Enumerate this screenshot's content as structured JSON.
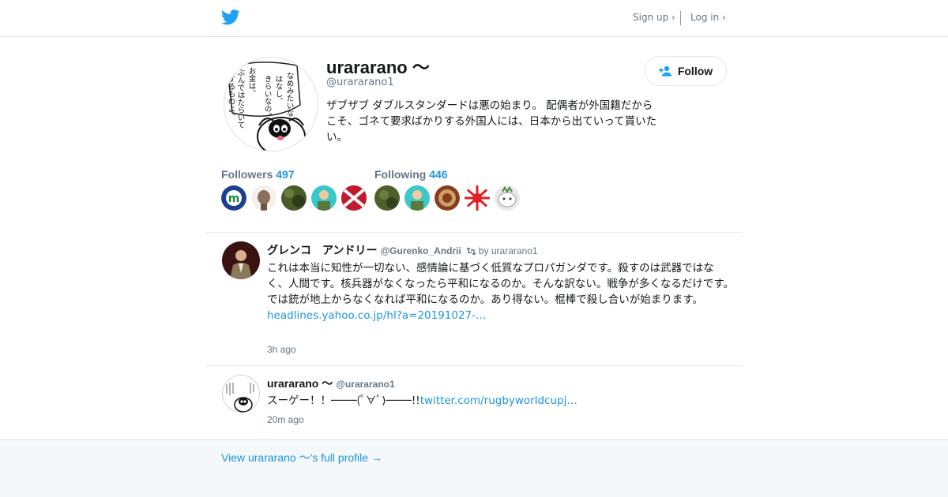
{
  "header": {
    "logo_icon": "twitter-bird-icon",
    "brand_color": "#1da1f2",
    "signup_label": "Sign up ›",
    "login_label": "Log in ›"
  },
  "profile": {
    "display_name": "urararano 〜",
    "screen_name": "@urararano1",
    "bio": "ザブザブ ダブルスタンダードは悪の始まり。 配偶者が外国籍だからこそ、ゴネて要求ばかりする外国人には、日本から出ていって貰いたい。",
    "follow_label": "Follow",
    "follow_icon": "add-user-icon",
    "avatar_text": "な めみたいな はなし きらいなの。 お金は、 ぶんではたらいて するものよ。"
  },
  "followers": {
    "label": "Followers",
    "count": "497",
    "avatar_colors": [
      "#1d3f8f",
      "#8a6f5a",
      "#4a5b2a",
      "#37c9c9",
      "#c01a2c"
    ]
  },
  "following": {
    "label": "Following",
    "count": "446",
    "avatar_colors": [
      "#4f5f2c",
      "#3ec8c8",
      "#8b3a1a",
      "#e01f26",
      "#e9e9e9"
    ]
  },
  "tweets": [
    {
      "name": "グレンコ　アンドリー",
      "handle": "@Gurenko_Andrii",
      "retweet_icon": "retweet-icon",
      "retweeted_by": "by urararano1",
      "text": "これは本当に知性が一切ない、感情論に基づく低質なプロパガンダです。殺すのは武器ではなく、人間です。核兵器がなくなったら平和になるのか。そんな訳ない。戦争が多くなるだけです。では銃が地上からなくなれば平和になるのか。あり得ない。棍棒で殺し合いが始まります。",
      "link": "headlines.yahoo.co.jp/hl?a=20191027-…",
      "time": "3h ago"
    },
    {
      "name": "urararano 〜",
      "handle": "@urararano1",
      "text": "スーゲー！！────(ﾟ∀ﾟ)────!!",
      "link": "twitter.com/rugbyworldcupj…",
      "time": "20m ago"
    }
  ],
  "footer": {
    "full_profile_label": "View urararano 〜's full profile →"
  }
}
